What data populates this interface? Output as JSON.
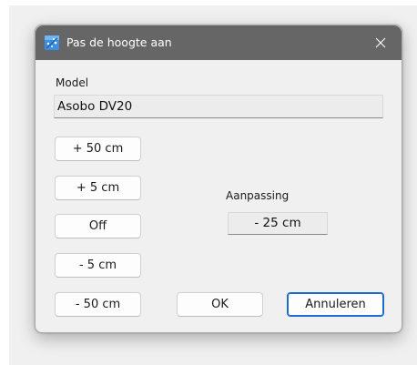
{
  "window": {
    "title": "Pas de hoogte aan",
    "icon": "app-icon",
    "close_icon": "close-icon"
  },
  "model": {
    "label": "Model",
    "value": "Asobo DV20"
  },
  "height_buttons": {
    "plus_50": "+ 50 cm",
    "plus_5": "+ 5 cm",
    "off": "Off",
    "minus_5": "- 5 cm",
    "minus_50": "- 50 cm"
  },
  "adjustment": {
    "label": "Aanpassing",
    "value": "- 25 cm"
  },
  "actions": {
    "ok_label": "OK",
    "cancel_label": "Annuleren"
  },
  "colors": {
    "titlebar": "#666666",
    "dialog_background": "#f0f0f0",
    "default_button_border": "#1d6ad0"
  }
}
